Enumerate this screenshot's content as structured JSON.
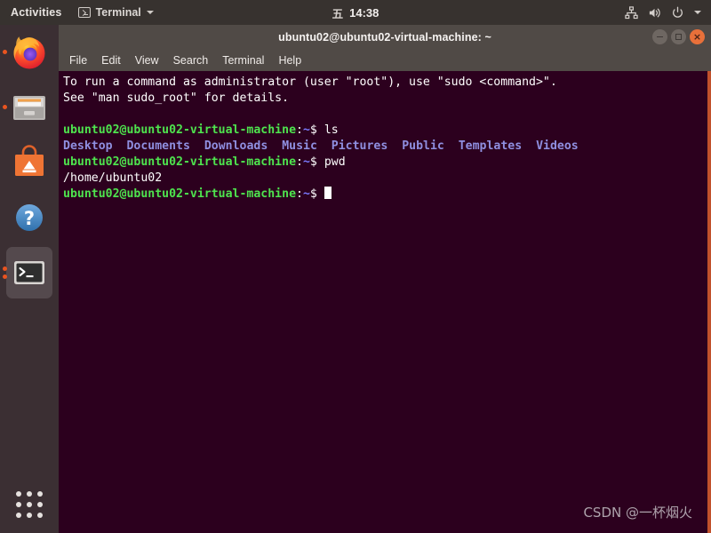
{
  "topbar": {
    "activities_label": "Activities",
    "app_menu": {
      "icon": "terminal-icon",
      "label": "Terminal",
      "caret": "chevron-down-icon"
    },
    "clock": {
      "weekday": "五",
      "time": "14:38"
    },
    "tray": [
      {
        "name": "network-icon"
      },
      {
        "name": "volume-icon"
      },
      {
        "name": "power-icon"
      },
      {
        "name": "chevron-down-icon"
      }
    ],
    "bg_color": "#37322f"
  },
  "dock": {
    "bg_color": "#3b2f33",
    "accent_color": "#e95420",
    "items": [
      {
        "name": "firefox",
        "label": "Firefox",
        "running": true,
        "active": false,
        "dots": 1
      },
      {
        "name": "files",
        "label": "Files",
        "running": true,
        "active": false,
        "dots": 1
      },
      {
        "name": "ubuntu-software",
        "label": "Ubuntu Software",
        "running": false,
        "active": false,
        "dots": 0
      },
      {
        "name": "help",
        "label": "Help",
        "running": false,
        "active": false,
        "dots": 0
      },
      {
        "name": "terminal",
        "label": "Terminal",
        "running": true,
        "active": true,
        "dots": 2
      }
    ],
    "show_apps_label": "Show Applications"
  },
  "window": {
    "title": "ubuntu02@ubuntu02-virtual-machine: ~",
    "titlebar_color": "#504a46",
    "controls": {
      "minimize": "−",
      "maximize": "□",
      "close": "×"
    },
    "menu": [
      "File",
      "Edit",
      "View",
      "Search",
      "Terminal",
      "Help"
    ]
  },
  "terminal": {
    "bg_color": "#2c001e",
    "fg_color": "#ffffff",
    "prompt_user_color": "#4ee44e",
    "prompt_path_color": "#7a7aff",
    "dir_color": "#8f8fe0",
    "border_color": "#c1512c",
    "lines": [
      {
        "type": "text",
        "text": "To run a command as administrator (user \"root\"), use \"sudo <command>\"."
      },
      {
        "type": "text",
        "text": "See \"man sudo_root\" for details."
      },
      {
        "type": "blank",
        "text": ""
      },
      {
        "type": "prompt",
        "user": "ubuntu02@ubuntu02-virtual-machine",
        "sep": ":",
        "path": "~",
        "tail": "$ ",
        "command": "ls"
      },
      {
        "type": "dirs",
        "items": [
          "Desktop",
          "Documents",
          "Downloads",
          "Music",
          "Pictures",
          "Public",
          "Templates",
          "Videos"
        ]
      },
      {
        "type": "prompt",
        "user": "ubuntu02@ubuntu02-virtual-machine",
        "sep": ":",
        "path": "~",
        "tail": "$ ",
        "command": "pwd"
      },
      {
        "type": "text",
        "text": "/home/ubuntu02"
      },
      {
        "type": "prompt-cursor",
        "user": "ubuntu02@ubuntu02-virtual-machine",
        "sep": ":",
        "path": "~",
        "tail": "$ ",
        "command": ""
      }
    ]
  },
  "watermark": {
    "text": "CSDN @一杯烟火"
  }
}
